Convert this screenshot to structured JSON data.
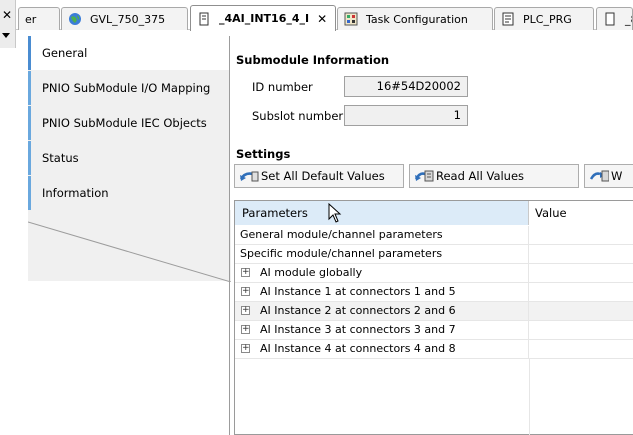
{
  "tabs": [
    {
      "label": "er",
      "icon": "none",
      "close": false
    },
    {
      "label": "GVL_750_375",
      "icon": "globe-icon",
      "close": false
    },
    {
      "label": "_4AI_INT16_4_I",
      "icon": "device-icon",
      "close": true
    },
    {
      "label": "Task Configuration",
      "icon": "task-config-icon",
      "close": false
    },
    {
      "label": "PLC_PRG",
      "icon": "program-icon",
      "close": false
    },
    {
      "label": "_8",
      "icon": "device-icon",
      "close": false
    }
  ],
  "nav": {
    "items": [
      {
        "label": "General"
      },
      {
        "label": "PNIO SubModule I/O Mapping"
      },
      {
        "label": "PNIO SubModule IEC Objects"
      },
      {
        "label": "Status"
      },
      {
        "label": "Information"
      }
    ]
  },
  "submodule": {
    "heading": "Submodule Information",
    "id_label": "ID number",
    "id_value": "16#54D20002",
    "slot_label": "Subslot number",
    "slot_value": "1"
  },
  "settings": {
    "heading": "Settings",
    "buttons": [
      {
        "label": "Set All Default Values"
      },
      {
        "label": "Read All Values"
      },
      {
        "label": "W"
      }
    ]
  },
  "grid": {
    "col_params": "Parameters",
    "col_value": "Value",
    "rows": [
      {
        "label": "General module/channel parameters",
        "expandable": false
      },
      {
        "label": "Specific module/channel parameters",
        "expandable": false
      },
      {
        "label": "AI module globally",
        "expandable": true
      },
      {
        "label": "AI Instance 1 at connectors 1 and 5",
        "expandable": true
      },
      {
        "label": "AI Instance 2 at connectors 2 and 6",
        "expandable": true
      },
      {
        "label": "AI Instance 3 at connectors 3 and 7",
        "expandable": true
      },
      {
        "label": "AI Instance 4 at connectors 4 and 8",
        "expandable": true
      }
    ]
  },
  "colors": {
    "accent": "#4a8cd1",
    "header_highlight": "#dcebf8",
    "panel": "#f0f0f0"
  }
}
